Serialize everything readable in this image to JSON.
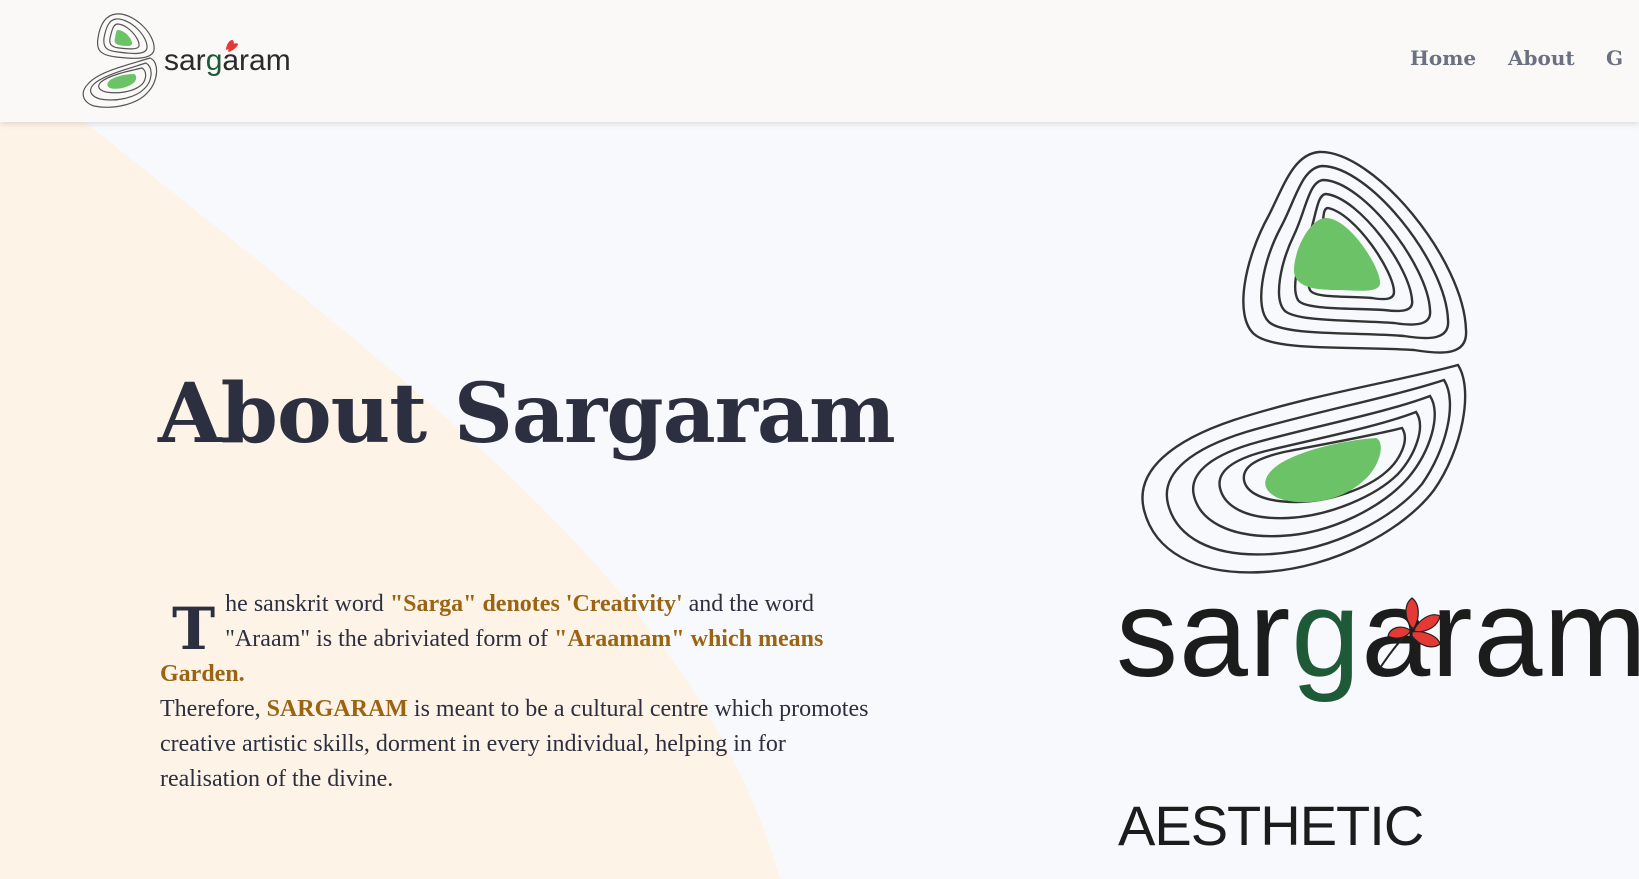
{
  "header": {
    "logo_text": "sargaram",
    "nav": [
      {
        "label": "Home"
      },
      {
        "label": "About"
      },
      {
        "label": "G"
      }
    ]
  },
  "hero": {
    "title": "About Sargaram",
    "dropcap": "T",
    "p1_a": "he sanskrit word ",
    "p1_hl1": "\"Sarga\" denotes 'Creativity'",
    "p1_b": " and the word \"Araam\" is the abriviated form of ",
    "p1_hl2": "\"Araamam\" which means Garden.",
    "p2_a": "Therefore, ",
    "p2_hl": "SARGARAM",
    "p2_b": " is meant to be a cultural centre which promotes creative artistic skills, dorment in every individual, helping in for realisation of the divine."
  },
  "brand": {
    "word_pre": "sar",
    "word_g": "g",
    "word_post": "aram",
    "subtitle": "AESTHETIC"
  },
  "colors": {
    "accent": "#9a6412",
    "title": "#2c2f3f",
    "leaf_green": "#6cc266",
    "brand_green": "#1e5a38",
    "flower_red": "#e53935",
    "peach_bg": "#fdf3e7"
  }
}
